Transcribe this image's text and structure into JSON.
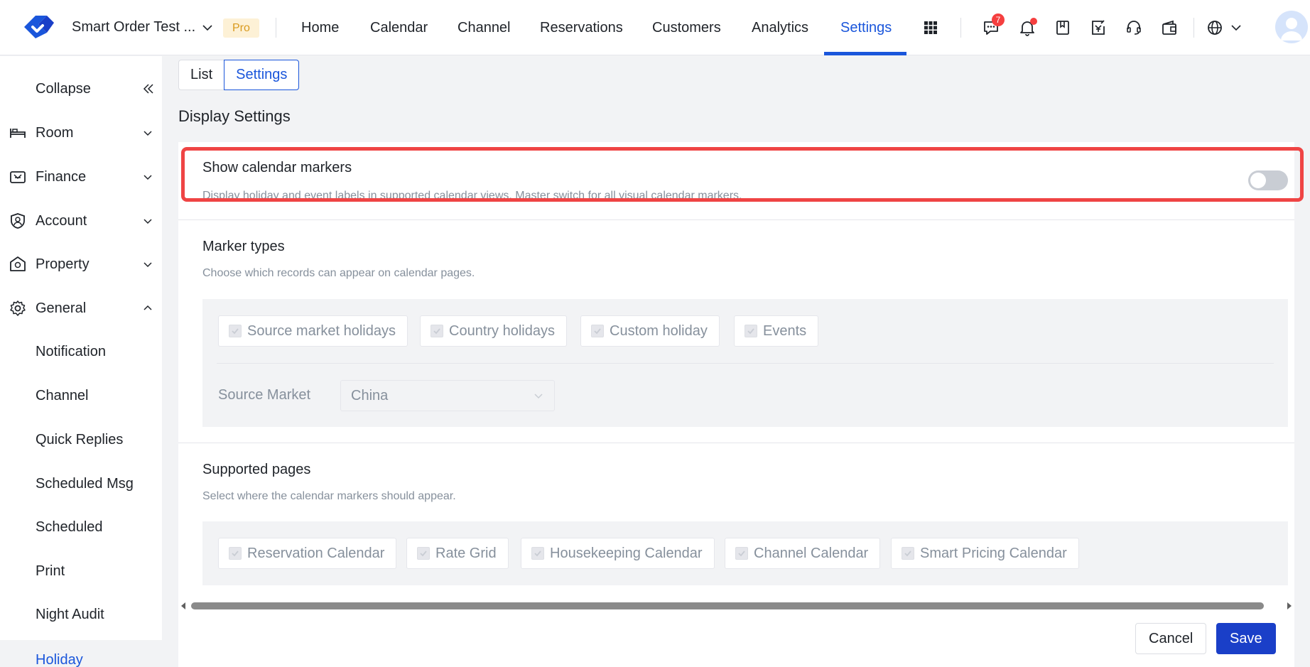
{
  "header": {
    "property_name": "Smart Order Test ...",
    "plan_badge": "Pro",
    "nav": [
      "Home",
      "Calendar",
      "Channel",
      "Reservations",
      "Customers",
      "Analytics",
      "Settings"
    ],
    "active_nav": "Settings",
    "message_count": "7",
    "accent_color": "#1a56db"
  },
  "sidebar": {
    "collapse_label": "Collapse",
    "items": [
      {
        "label": "Room",
        "icon": "bed-icon"
      },
      {
        "label": "Finance",
        "icon": "cash-register-icon"
      },
      {
        "label": "Account",
        "icon": "user-shield-icon"
      },
      {
        "label": "Property",
        "icon": "property-icon"
      },
      {
        "label": "General",
        "icon": "gear-icon"
      }
    ],
    "sub_items": [
      "Notification",
      "Channel",
      "Quick Replies",
      "Scheduled Msg",
      "Scheduled",
      "Print",
      "Night Audit",
      "Holiday"
    ],
    "active_sub_item": "Holiday"
  },
  "tabs": [
    "List",
    "Settings"
  ],
  "active_tab": "Settings",
  "section_title": "Display Settings",
  "calendar_markers": {
    "title": "Show calendar markers",
    "description": "Display holiday and event labels in supported calendar views. Master switch for all visual calendar markers.",
    "enabled": false
  },
  "marker_types": {
    "title": "Marker types",
    "description": "Choose which records can appear on calendar pages.",
    "options": [
      "Source market holidays",
      "Country holidays",
      "Custom holiday",
      "Events"
    ],
    "source_market_label": "Source Market",
    "source_market_value": "China"
  },
  "supported_pages": {
    "title": "Supported pages",
    "description": "Select where the calendar markers should appear.",
    "options": [
      "Reservation Calendar",
      "Rate Grid",
      "Housekeeping Calendar",
      "Channel Calendar",
      "Smart Pricing Calendar"
    ]
  },
  "footer": {
    "cancel_label": "Cancel",
    "save_label": "Save"
  }
}
